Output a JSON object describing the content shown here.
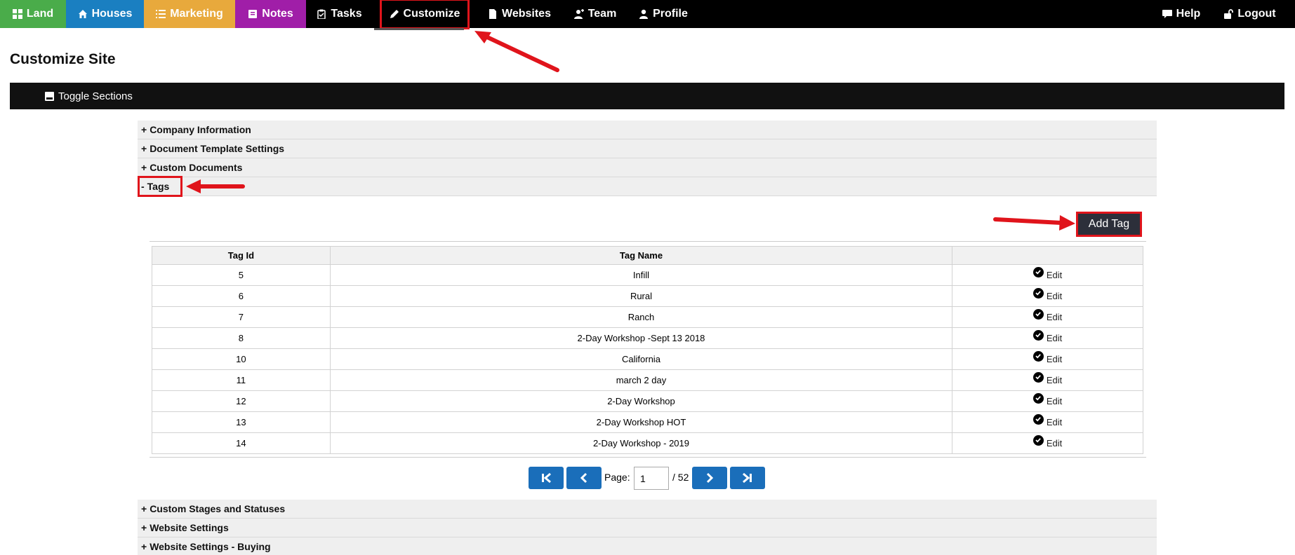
{
  "nav": {
    "land": "Land",
    "houses": "Houses",
    "marketing": "Marketing",
    "notes": "Notes",
    "tasks": "Tasks",
    "customize": "Customize",
    "websites": "Websites",
    "team": "Team",
    "profile": "Profile",
    "help": "Help",
    "logout": "Logout"
  },
  "page_title": "Customize Site",
  "toggle_label": "Toggle Sections",
  "sections_top": [
    {
      "sign": "+",
      "label": "Company Information"
    },
    {
      "sign": "+",
      "label": "Document Template Settings"
    },
    {
      "sign": "+",
      "label": "Custom Documents"
    },
    {
      "sign": "-",
      "label": "Tags"
    }
  ],
  "add_tag_label": "Add Tag",
  "table": {
    "headers": [
      "Tag Id",
      "Tag Name",
      ""
    ],
    "edit_label": "Edit",
    "rows": [
      {
        "id": "5",
        "name": "Infill"
      },
      {
        "id": "6",
        "name": "Rural"
      },
      {
        "id": "7",
        "name": "Ranch"
      },
      {
        "id": "8",
        "name": "2-Day Workshop -Sept 13 2018"
      },
      {
        "id": "10",
        "name": "California"
      },
      {
        "id": "11",
        "name": "march 2 day"
      },
      {
        "id": "12",
        "name": "2-Day Workshop"
      },
      {
        "id": "13",
        "name": "2-Day Workshop HOT"
      },
      {
        "id": "14",
        "name": "2-Day Workshop - 2019"
      }
    ]
  },
  "pager": {
    "label": "Page:",
    "current": "1",
    "total": "/ 52"
  },
  "sections_bottom": [
    {
      "sign": "+",
      "label": "Custom Stages and Statuses"
    },
    {
      "sign": "+",
      "label": "Website Settings"
    },
    {
      "sign": "+",
      "label": "Website Settings - Buying"
    }
  ],
  "colors": {
    "land": "#4aac4a",
    "houses": "#1a7fc1",
    "marketing": "#e8a93c",
    "notes": "#a01ea8",
    "annotation": "#e0141b",
    "pager": "#1a6eba"
  }
}
